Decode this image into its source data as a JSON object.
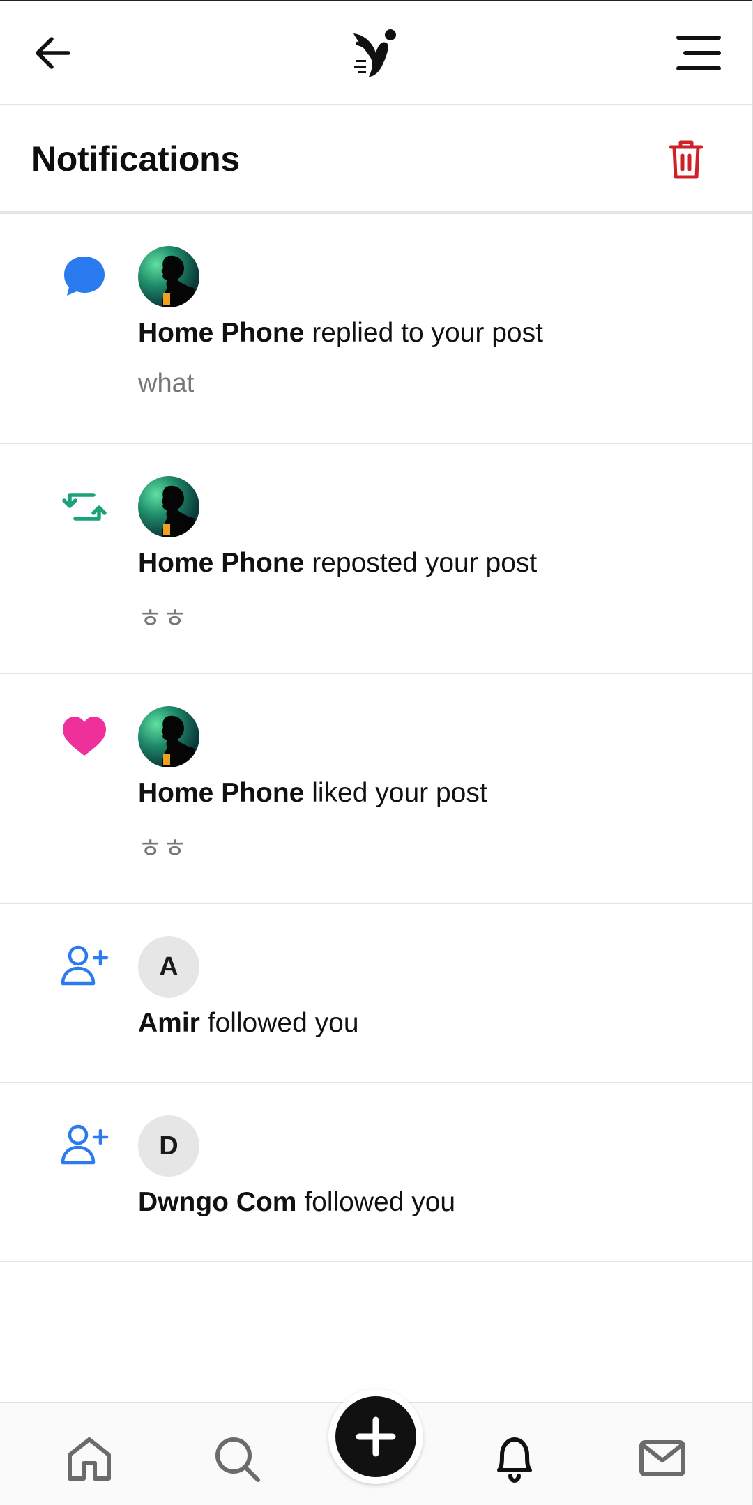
{
  "header": {
    "title": "Notifications",
    "back_icon": "arrow-left-icon",
    "logo_icon": "bird-logo-icon",
    "menu_icon": "hamburger-menu-icon",
    "trash_icon": "trash-icon"
  },
  "colors": {
    "reply": "#2b7bf0",
    "repost": "#1aa37a",
    "like": "#f0309a",
    "follow": "#2b7bf0",
    "trash": "#d0202a"
  },
  "notifications": [
    {
      "type": "reply",
      "icon": "speech-bubble-icon",
      "name": "Home Phone",
      "action": "replied to your post",
      "snippet": "what"
    },
    {
      "type": "repost",
      "icon": "repost-icon",
      "name": "Home Phone",
      "action": "reposted your post",
      "snippet": "ㅎㅎ"
    },
    {
      "type": "like",
      "icon": "heart-icon",
      "name": "Home Phone",
      "action": "liked your post",
      "snippet": "ㅎㅎ"
    },
    {
      "type": "follow",
      "icon": "user-plus-icon",
      "avatar_letter": "A",
      "name": "Amir",
      "action": "followed you"
    },
    {
      "type": "follow",
      "icon": "user-plus-icon",
      "avatar_letter": "D",
      "name": "Dwngo Com",
      "action": "followed you"
    }
  ],
  "bottom_nav": {
    "items": [
      "home-icon",
      "search-icon",
      "compose-plus-icon",
      "bell-icon",
      "mail-icon"
    ],
    "active": "bell-icon"
  }
}
